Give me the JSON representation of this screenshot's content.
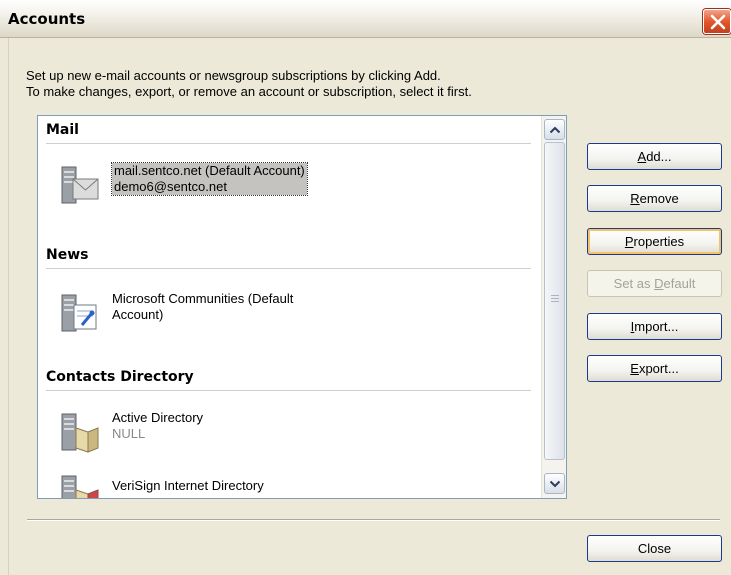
{
  "window": {
    "title": "Accounts"
  },
  "intro": {
    "line1": "Set up new e-mail accounts or newsgroup subscriptions by clicking Add.",
    "line2": "To make changes, export, or remove an account or subscription, select it first."
  },
  "groups": {
    "mail": {
      "heading": "Mail",
      "accounts": [
        {
          "line1": "mail.sentco.net (Default Account)",
          "line2": "demo6@sentco.net",
          "icon": "mail-server-icon",
          "selected": true
        }
      ]
    },
    "news": {
      "heading": "News",
      "accounts": [
        {
          "line1": "Microsoft Communities (Default",
          "line2": "Account)",
          "icon": "news-server-icon"
        }
      ]
    },
    "contacts": {
      "heading": "Contacts Directory",
      "accounts": [
        {
          "line1": "Active Directory",
          "line2": "NULL",
          "icon": "directory-server-icon"
        },
        {
          "line1": "VeriSign Internet Directory",
          "line2": "",
          "icon": "directory-server-icon"
        }
      ]
    }
  },
  "buttons": {
    "add": {
      "pre": "",
      "key": "A",
      "post": "dd..."
    },
    "remove": {
      "pre": "",
      "key": "R",
      "post": "emove"
    },
    "properties": {
      "pre": "",
      "key": "P",
      "post": "roperties"
    },
    "set_default": {
      "pre": "Set as ",
      "key": "D",
      "post": "efault"
    },
    "import": {
      "pre": "",
      "key": "I",
      "post": "mport..."
    },
    "export": {
      "pre": "",
      "key": "E",
      "post": "xport..."
    },
    "close": "Close"
  },
  "colors": {
    "dialog_bg": "#ece9d8",
    "button_border": "#1b3a8c",
    "close_button": "#e3572b",
    "selection_bg": "#c4c3c0"
  }
}
